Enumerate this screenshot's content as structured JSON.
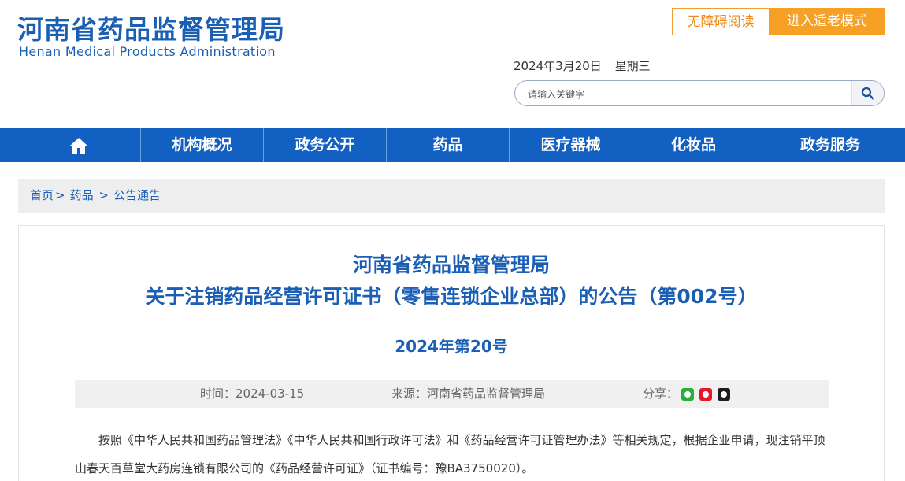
{
  "header": {
    "logo_cn": "河南省药品监督管理局",
    "logo_en": "Henan Medical Products Administration",
    "btn_accessible": "无障碍阅读",
    "btn_elder": "进入适老模式",
    "date": "2024年3月20日",
    "weekday": "星期三",
    "search_placeholder": "请输入关键字"
  },
  "nav": {
    "home_icon": "home-icon",
    "items": [
      "机构概况",
      "政务公开",
      "药品",
      "医疗器械",
      "化妆品",
      "政务服务"
    ]
  },
  "breadcrumb": {
    "home": "首页",
    "sep1": ">",
    "level1": "药品",
    "sep2": ">",
    "level2": "公告通告"
  },
  "article": {
    "title_line1": "河南省药品监督管理局",
    "title_line2": "关于注销药品经营许可证书（零售连锁企业总部）的公告（第002号）",
    "doc_no": "2024年第20号",
    "meta": {
      "time": "时间：2024-03-15",
      "source": "来源：河南省药品监督管理局",
      "share_label": "分享："
    },
    "paragraphs": [
      "按照《中华人民共和国药品管理法》《中华人民共和国行政许可法》和《药品经营许可证管理办法》等相关规定，根据企业申请，现注销平顶山春天百草堂大药房连锁有限公司的《药品经营许可证》（证书编号：豫BA3750020）。"
    ]
  },
  "colors": {
    "brand_blue": "#1160c2",
    "accent_orange": "#f6a026"
  }
}
